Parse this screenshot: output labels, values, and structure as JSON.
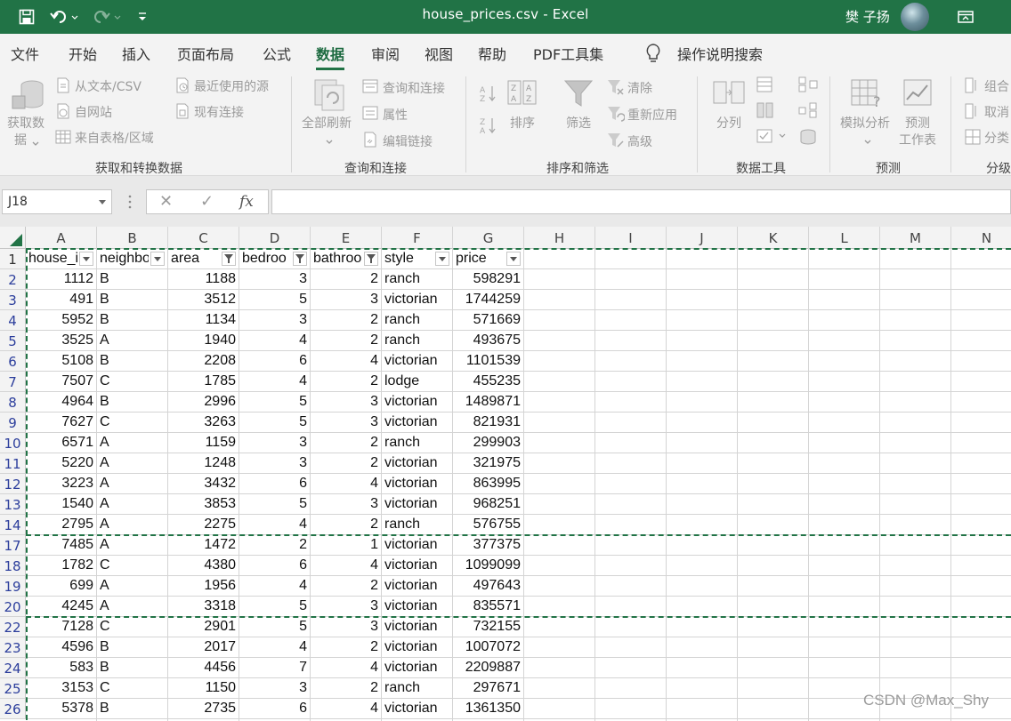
{
  "window": {
    "title": "house_prices.csv  -  Excel",
    "user": "樊 子扬"
  },
  "menu": {
    "tabs": [
      "文件",
      "开始",
      "插入",
      "页面布局",
      "公式",
      "数据",
      "审阅",
      "视图",
      "帮助",
      "PDF工具集"
    ],
    "active_tab": "数据",
    "search": "操作说明搜索"
  },
  "ribbon": {
    "get_data": {
      "get_data_line1": "获取数",
      "get_data_line2": "据",
      "from_text": "从文本/CSV",
      "from_web": "自网站",
      "from_table": "来自表格/区域",
      "recent_sources": "最近使用的源",
      "existing_connections": "现有连接",
      "label": "获取和转换数据"
    },
    "queries": {
      "refresh_all": "全部刷新",
      "queries_connections": "查询和连接",
      "properties": "属性",
      "edit_links": "编辑链接",
      "label": "查询和连接"
    },
    "sort_filter": {
      "sort": "排序",
      "filter": "筛选",
      "clear": "清除",
      "reapply": "重新应用",
      "advanced": "高级",
      "label": "排序和筛选"
    },
    "data_tools": {
      "text_to_columns": "分列",
      "label": "数据工具"
    },
    "forecast": {
      "what_if": "模拟分析",
      "forecast_sheet_1": "预测",
      "forecast_sheet_2": "工作表",
      "label": "预测"
    },
    "outline": {
      "group": "组合",
      "ungroup": "取消",
      "subtotal": "分类",
      "label": "分级"
    }
  },
  "formula_bar": {
    "name_box": "J18",
    "formula": ""
  },
  "sheet": {
    "columns": [
      "A",
      "B",
      "C",
      "D",
      "E",
      "F",
      "G",
      "H",
      "I",
      "J",
      "K",
      "L",
      "M",
      "N"
    ],
    "headers": [
      "house_i",
      "neighbo",
      "area",
      "bedroo",
      "bathroo",
      "style",
      "price"
    ],
    "filter_active": [
      false,
      false,
      true,
      true,
      true,
      false,
      false
    ],
    "rows": [
      {
        "n": "1"
      },
      {
        "n": "2",
        "v": [
          "1112",
          "B",
          "1188",
          "3",
          "2",
          "ranch",
          "598291"
        ]
      },
      {
        "n": "3",
        "v": [
          "491",
          "B",
          "3512",
          "5",
          "3",
          "victorian",
          "1744259"
        ]
      },
      {
        "n": "4",
        "v": [
          "5952",
          "B",
          "1134",
          "3",
          "2",
          "ranch",
          "571669"
        ]
      },
      {
        "n": "5",
        "v": [
          "3525",
          "A",
          "1940",
          "4",
          "2",
          "ranch",
          "493675"
        ]
      },
      {
        "n": "6",
        "v": [
          "5108",
          "B",
          "2208",
          "6",
          "4",
          "victorian",
          "1101539"
        ]
      },
      {
        "n": "7",
        "v": [
          "7507",
          "C",
          "1785",
          "4",
          "2",
          "lodge",
          "455235"
        ]
      },
      {
        "n": "8",
        "v": [
          "4964",
          "B",
          "2996",
          "5",
          "3",
          "victorian",
          "1489871"
        ]
      },
      {
        "n": "9",
        "v": [
          "7627",
          "C",
          "3263",
          "5",
          "3",
          "victorian",
          "821931"
        ]
      },
      {
        "n": "10",
        "v": [
          "6571",
          "A",
          "1159",
          "3",
          "2",
          "ranch",
          "299903"
        ]
      },
      {
        "n": "11",
        "v": [
          "5220",
          "A",
          "1248",
          "3",
          "2",
          "victorian",
          "321975"
        ]
      },
      {
        "n": "12",
        "v": [
          "3223",
          "A",
          "3432",
          "6",
          "4",
          "victorian",
          "863995"
        ]
      },
      {
        "n": "13",
        "v": [
          "1540",
          "A",
          "3853",
          "5",
          "3",
          "victorian",
          "968251"
        ]
      },
      {
        "n": "14",
        "v": [
          "2795",
          "A",
          "2275",
          "4",
          "2",
          "ranch",
          "576755"
        ]
      },
      {
        "n": "17",
        "v": [
          "7485",
          "A",
          "1472",
          "2",
          "1",
          "victorian",
          "377375"
        ]
      },
      {
        "n": "18",
        "v": [
          "1782",
          "C",
          "4380",
          "6",
          "4",
          "victorian",
          "1099099"
        ]
      },
      {
        "n": "19",
        "v": [
          "699",
          "A",
          "1956",
          "4",
          "2",
          "victorian",
          "497643"
        ]
      },
      {
        "n": "20",
        "v": [
          "4245",
          "A",
          "3318",
          "5",
          "3",
          "victorian",
          "835571"
        ]
      },
      {
        "n": "22",
        "v": [
          "7128",
          "C",
          "2901",
          "5",
          "3",
          "victorian",
          "732155"
        ]
      },
      {
        "n": "23",
        "v": [
          "4596",
          "B",
          "2017",
          "4",
          "2",
          "victorian",
          "1007072"
        ]
      },
      {
        "n": "24",
        "v": [
          "583",
          "B",
          "4456",
          "7",
          "4",
          "victorian",
          "2209887"
        ]
      },
      {
        "n": "25",
        "v": [
          "3153",
          "C",
          "1150",
          "3",
          "2",
          "ranch",
          "297671"
        ]
      },
      {
        "n": "26",
        "v": [
          "5378",
          "B",
          "2735",
          "6",
          "4",
          "victorian",
          "1361350"
        ]
      }
    ]
  },
  "watermark": "CSDN @Max_Shy"
}
